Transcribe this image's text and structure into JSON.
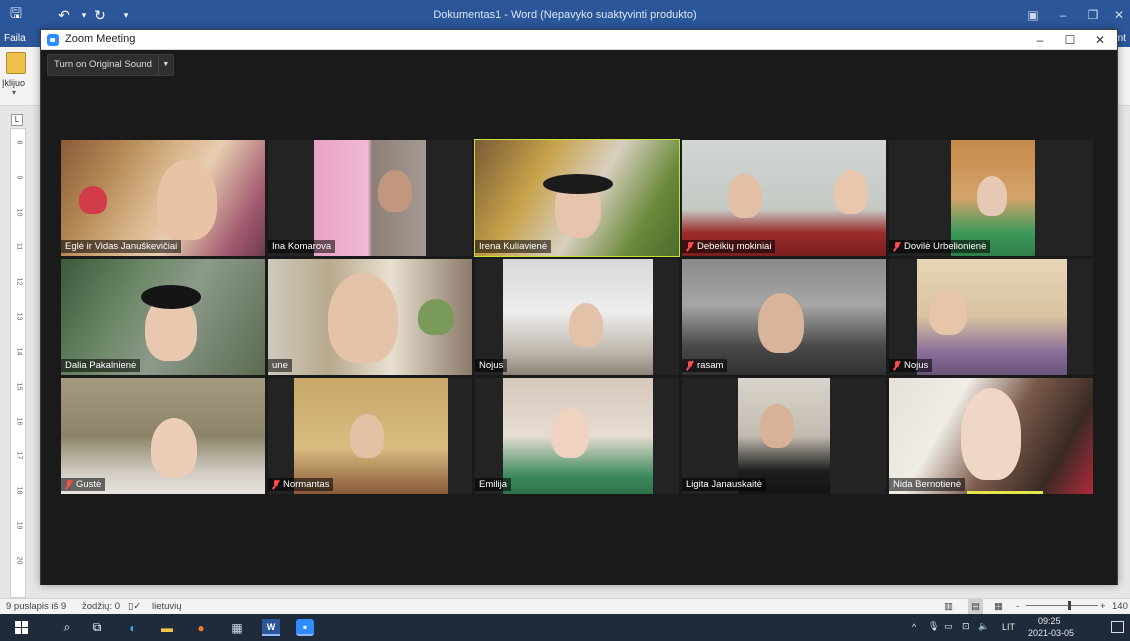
{
  "word": {
    "title": "Dokumentas1 - Word (Nepavyko suaktyvinti produkto)",
    "file_tab": "Faila",
    "print_tab": "rint",
    "paste_label": "Įklijuo",
    "ruler_tab": "L",
    "ruler_numbers": [
      "8",
      "9",
      "10",
      "11",
      "12",
      "13",
      "14",
      "15",
      "16",
      "17",
      "18",
      "19",
      "20"
    ],
    "status": {
      "page": "9 puslapis iš 9",
      "words": "žodžių: 0",
      "language": "lietuvių",
      "zoom": "140",
      "zoom_minus": "-",
      "zoom_plus": "+"
    }
  },
  "zoom": {
    "window_title": "Zoom Meeting",
    "original_sound_label": "Turn on Original Sound",
    "dropdown_arrow": "▼",
    "participants": [
      {
        "name": "Eglė ir Vidas Januškevičiai",
        "muted": false,
        "active": false
      },
      {
        "name": "Ina Komarova",
        "muted": false,
        "active": false
      },
      {
        "name": "Irena Kuliavienė",
        "muted": false,
        "active": true
      },
      {
        "name": "Debeikių mokiniai",
        "muted": true,
        "active": false
      },
      {
        "name": "Dovilė Urbelionienė",
        "muted": true,
        "active": false
      },
      {
        "name": "Dalia Pakalnienė",
        "muted": false,
        "active": false
      },
      {
        "name": "une",
        "muted": false,
        "active": false
      },
      {
        "name": "Nojus",
        "muted": false,
        "active": false
      },
      {
        "name": "rasam",
        "muted": true,
        "active": false
      },
      {
        "name": "Nojus",
        "muted": true,
        "active": false
      },
      {
        "name": "Gustė",
        "muted": true,
        "active": false
      },
      {
        "name": "Normantas",
        "muted": true,
        "active": false
      },
      {
        "name": "Emilija",
        "muted": false,
        "active": false
      },
      {
        "name": "Ligita Janauskaitė",
        "muted": false,
        "active": false
      },
      {
        "name": "Nida Bernotienė",
        "muted": false,
        "active": false
      }
    ]
  },
  "taskbar": {
    "tray_language": "LIT",
    "time": "09:25",
    "date": "2021-03-05",
    "tray_arrow": "^"
  }
}
